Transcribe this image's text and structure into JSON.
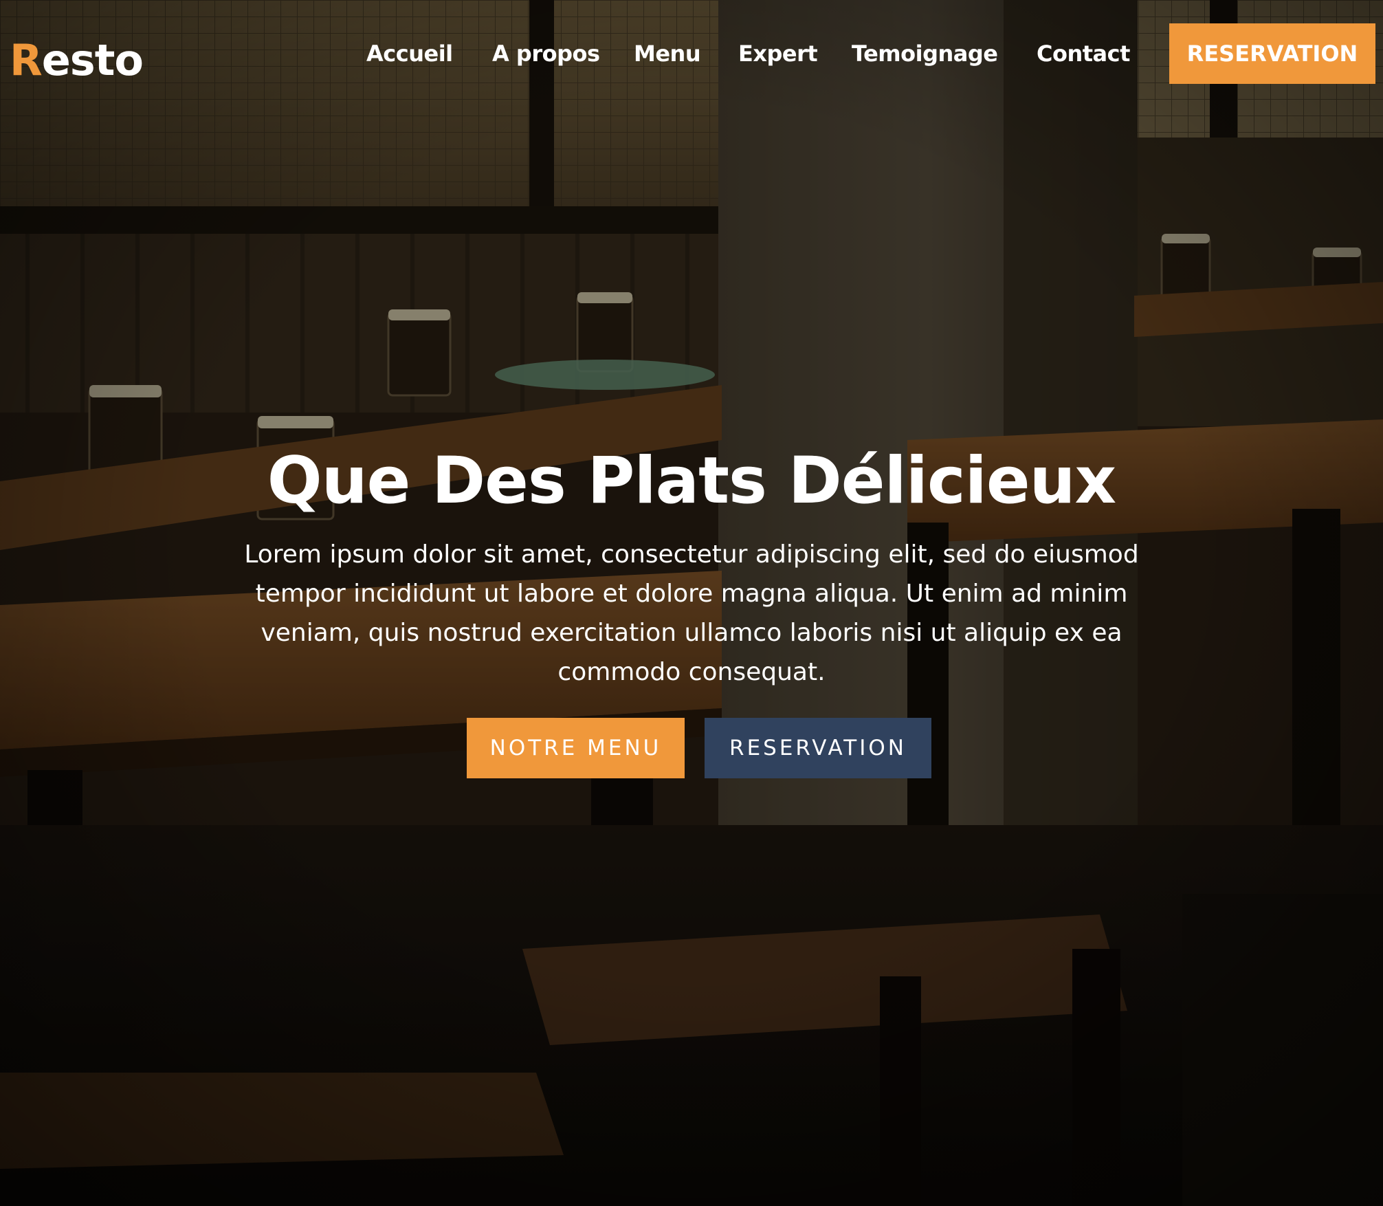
{
  "colors": {
    "accent": "#f0983b",
    "secondary": "#30425e",
    "text": "#ffffff"
  },
  "brand": {
    "logo_first_letter": "R",
    "logo_rest": "esto"
  },
  "nav": {
    "items": [
      {
        "label": "Accueil"
      },
      {
        "label": "A propos"
      },
      {
        "label": "Menu"
      },
      {
        "label": "Expert"
      },
      {
        "label": "Temoignage"
      },
      {
        "label": "Contact"
      }
    ],
    "cta_label": "RESERVATION"
  },
  "hero": {
    "title": "Que Des Plats Délicieux",
    "text": "Lorem ipsum dolor sit amet, consectetur adipiscing elit, sed do eiusmod tempor incididunt ut labore et dolore magna aliqua. Ut enim ad minim veniam, quis nostrud exercitation ullamco laboris nisi ut aliquip ex ea commodo consequat.",
    "primary_button": "NOTRE MENU",
    "secondary_button": "RESERVATION"
  }
}
